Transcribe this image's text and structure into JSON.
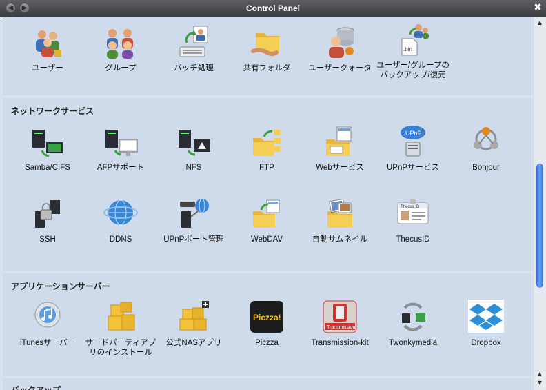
{
  "window": {
    "title": "Control Panel"
  },
  "sections": {
    "user": {
      "items": [
        {
          "label": "ユーザー"
        },
        {
          "label": "グループ"
        },
        {
          "label": "バッチ処理"
        },
        {
          "label": "共有フォルダ"
        },
        {
          "label": "ユーザークォータ"
        },
        {
          "label": "ユーザー/グループのバックアップ/復元"
        }
      ]
    },
    "network": {
      "heading": "ネットワークサービス",
      "items": [
        {
          "label": "Samba/CIFS"
        },
        {
          "label": "AFPサポート"
        },
        {
          "label": "NFS"
        },
        {
          "label": "FTP"
        },
        {
          "label": "Webサービス"
        },
        {
          "label": "UPnPサービス"
        },
        {
          "label": "Bonjour"
        },
        {
          "label": "SSH"
        },
        {
          "label": "DDNS"
        },
        {
          "label": "UPnPポート管理"
        },
        {
          "label": "WebDAV"
        },
        {
          "label": "自動サムネイル"
        },
        {
          "label": "ThecusID"
        }
      ]
    },
    "apps": {
      "heading": "アプリケーションサーバー",
      "items": [
        {
          "label": "iTunesサーバー"
        },
        {
          "label": "サードパーティアプリのインストール"
        },
        {
          "label": "公式NASアプリ"
        },
        {
          "label": "Piczza"
        },
        {
          "label": "Transmission-kit"
        },
        {
          "label": "Twonkymedia"
        },
        {
          "label": "Dropbox"
        }
      ]
    },
    "backup": {
      "heading": "バックアップ"
    }
  },
  "icons": {
    "piczza_text": "Piczza!",
    "transmission_text": "Transmission",
    "upnp_text": "UPnP",
    "bin_text": ".bin",
    "thecus_card_text": "Thecus ID"
  },
  "colors": {
    "titlebar": "#4a4b4e",
    "panel": "#cfdbeb",
    "scroll_thumb": "#3f7fe0"
  }
}
